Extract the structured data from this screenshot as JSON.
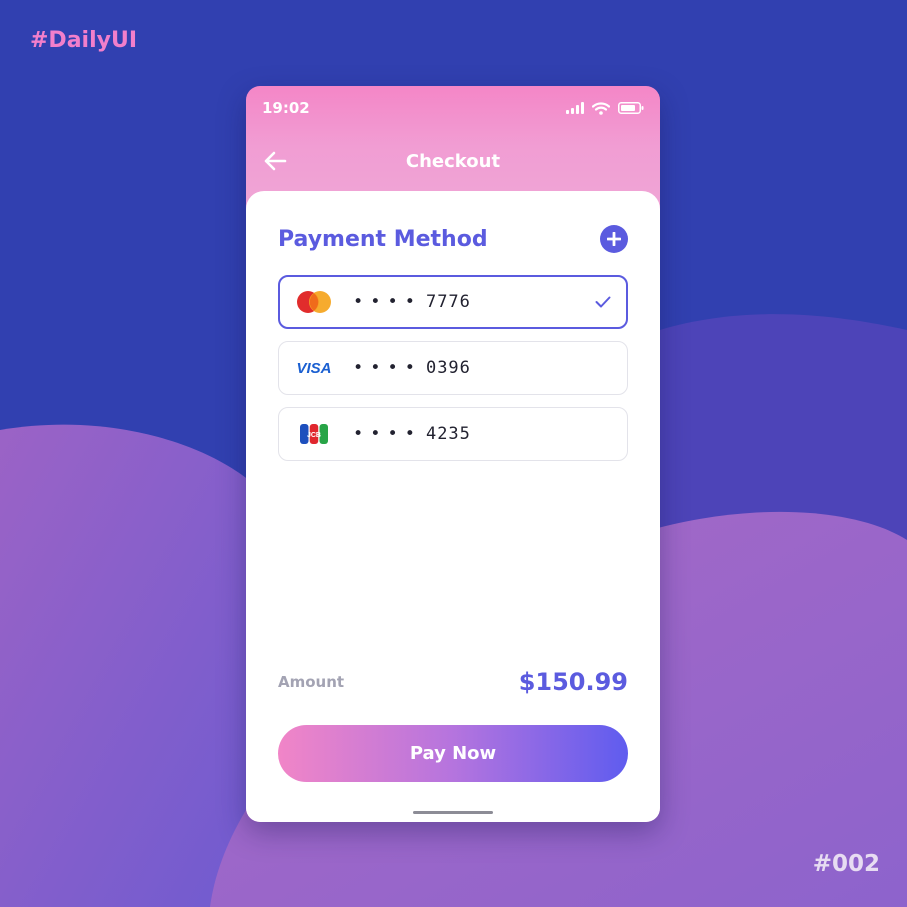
{
  "tags": {
    "top": "#DailyUI",
    "bottom": "#002"
  },
  "status_bar": {
    "time": "19:02"
  },
  "header": {
    "title": "Checkout",
    "back_icon": "arrow-left-icon"
  },
  "section": {
    "title": "Payment Method",
    "add_icon": "plus-circle-icon"
  },
  "cards": [
    {
      "brand": "mastercard",
      "dots": "••••",
      "last4": "7776",
      "selected": true
    },
    {
      "brand": "visa",
      "brand_label": "VISA",
      "dots": "••••",
      "last4": "0396",
      "selected": false
    },
    {
      "brand": "jcb",
      "brand_label": "JCB",
      "dots": "••••",
      "last4": "4235",
      "selected": false
    }
  ],
  "amount": {
    "label": "Amount",
    "value": "$150.99"
  },
  "pay_button": {
    "label": "Pay Now"
  },
  "colors": {
    "background": "#3140b0",
    "accent": "#5b5bdf",
    "header_pink": "#f486c7",
    "tag_pink": "#f27fcb"
  }
}
